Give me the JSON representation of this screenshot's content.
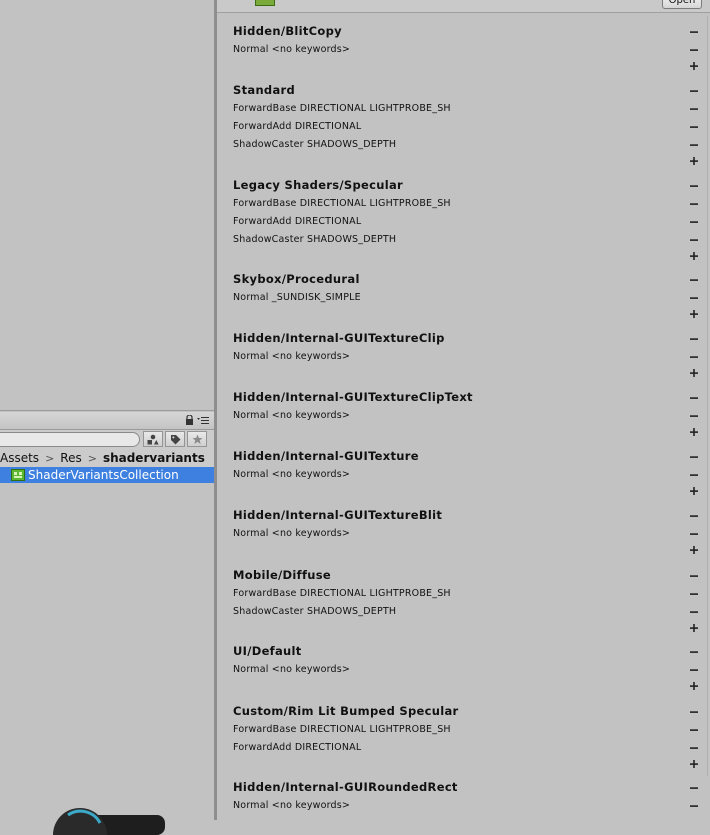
{
  "project": {
    "breadcrumb": [
      "Assets",
      "Res",
      "shadervariants"
    ],
    "selected_asset": "ShaderVariantsCollection"
  },
  "inspector": {
    "open_label": "Open",
    "shaders": [
      {
        "name": "Hidden/BlitCopy",
        "variants": [
          "Normal <no keywords>"
        ]
      },
      {
        "name": "Standard",
        "variants": [
          "ForwardBase DIRECTIONAL LIGHTPROBE_SH",
          "ForwardAdd DIRECTIONAL",
          "ShadowCaster SHADOWS_DEPTH"
        ]
      },
      {
        "name": "Legacy Shaders/Specular",
        "variants": [
          "ForwardBase DIRECTIONAL LIGHTPROBE_SH",
          "ForwardAdd DIRECTIONAL",
          "ShadowCaster SHADOWS_DEPTH"
        ]
      },
      {
        "name": "Skybox/Procedural",
        "variants": [
          "Normal _SUNDISK_SIMPLE"
        ]
      },
      {
        "name": "Hidden/Internal-GUITextureClip",
        "variants": [
          "Normal <no keywords>"
        ]
      },
      {
        "name": "Hidden/Internal-GUITextureClipText",
        "variants": [
          "Normal <no keywords>"
        ]
      },
      {
        "name": "Hidden/Internal-GUITexture",
        "variants": [
          "Normal <no keywords>"
        ]
      },
      {
        "name": "Hidden/Internal-GUITextureBlit",
        "variants": [
          "Normal <no keywords>"
        ]
      },
      {
        "name": "Mobile/Diffuse",
        "variants": [
          "ForwardBase DIRECTIONAL LIGHTPROBE_SH",
          "ShadowCaster SHADOWS_DEPTH"
        ]
      },
      {
        "name": "UI/Default",
        "variants": [
          "Normal <no keywords>"
        ]
      },
      {
        "name": "Custom/Rim Lit Bumped Specular",
        "variants": [
          "ForwardBase DIRECTIONAL LIGHTPROBE_SH",
          "ForwardAdd DIRECTIONAL"
        ]
      },
      {
        "name": "Hidden/Internal-GUIRoundedRect",
        "variants": [
          "Normal <no keywords>"
        ]
      }
    ]
  },
  "colors": {
    "selection": "#3d80df",
    "panel_bg": "#c2c2c2"
  }
}
